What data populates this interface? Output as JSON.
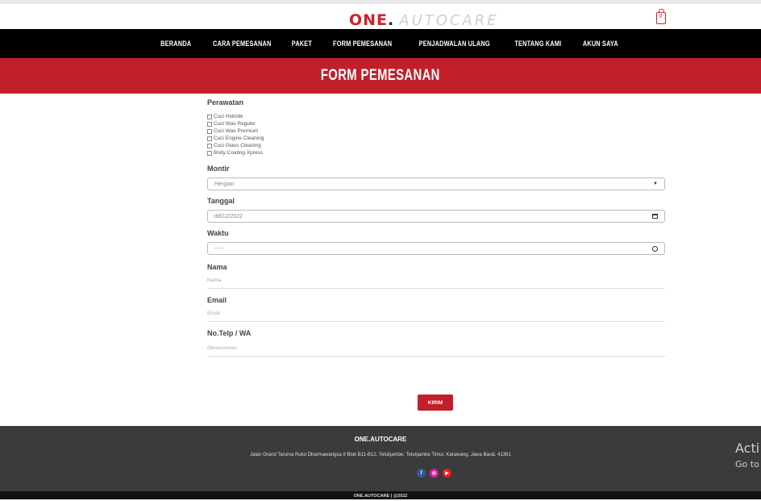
{
  "header": {
    "logo_one": "ONE",
    "logo_dot": ".",
    "logo_autocare": "AUTOCARE",
    "cart_count": "0"
  },
  "nav": {
    "items": [
      "BERANDA",
      "CARA PEMESANAN",
      "PAKET",
      "FORM PEMESANAN",
      "PENJADWALAN ULANG",
      "TENTANG KAMI",
      "AKUN SAYA"
    ]
  },
  "banner": {
    "title": "FORM PEMESANAN"
  },
  "form": {
    "perawatan_label": "Perawatan",
    "services": [
      "Cuci Hidrolik",
      "Cuci Wax Reguler",
      "Cuci Wax Premium",
      "Cuci Engine Cleaning",
      "Cuci Glass Cleaning",
      "Body Coating Xpress"
    ],
    "montir_label": "Montir",
    "montir_value": "Hergian",
    "tanggal_label": "Tanggal",
    "tanggal_value": "dd/12/2022",
    "waktu_label": "Waktu",
    "waktu_value": "--:--",
    "nama_label": "Nama",
    "nama_placeholder": "Nama",
    "email_label": "Email",
    "email_placeholder": "Email",
    "telp_label": "No.Telp / WA",
    "telp_placeholder": "08xxxxxxxxx",
    "submit_label": "KIRIM"
  },
  "footer": {
    "brand": "ONE.AUTOCARE",
    "address": "Jalan Grand Taruma Ruko Dharmawangsa II Blok B11-B12, Telukjambe, Telukjambe Timur, Karawang, Jawa Barat, 41361",
    "copyright": "ONE.AUTOCARE | @2022"
  },
  "watermark": {
    "line1": "Acti",
    "line2": "Go to"
  },
  "colors": {
    "accent": "#c1202a",
    "nav_bg": "#000000",
    "footer_bg": "#3b3b3b"
  }
}
